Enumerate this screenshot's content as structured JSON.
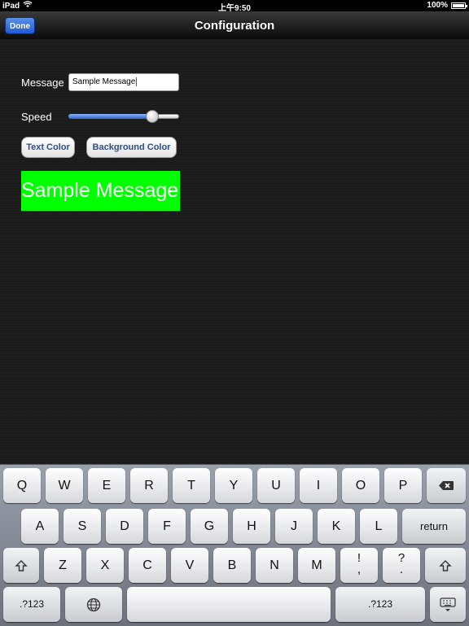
{
  "status": {
    "device": "iPad",
    "time": "上午9:50",
    "battery": "100%"
  },
  "nav": {
    "title": "Configuration",
    "done_label": "Done"
  },
  "form": {
    "message_label": "Message",
    "message_value": "Sample Message",
    "speed_label": "Speed",
    "speed_fraction": 0.79,
    "text_color_label": "Text Color",
    "background_color_label": "Background Color",
    "preview_text": "Sample Message",
    "preview_bg": "#00ff00",
    "preview_text_color": "#ffffff"
  },
  "keyboard": {
    "row1": [
      "Q",
      "W",
      "E",
      "R",
      "T",
      "Y",
      "U",
      "I",
      "O",
      "P"
    ],
    "row2": [
      "A",
      "S",
      "D",
      "F",
      "G",
      "H",
      "J",
      "K",
      "L"
    ],
    "row2_return": "return",
    "row3": [
      "Z",
      "X",
      "C",
      "V",
      "B",
      "N",
      "M"
    ],
    "row3_punct1_top": "!",
    "row3_punct1_bottom": ",",
    "row3_punct2_top": "?",
    "row3_punct2_bottom": ".",
    "num_key": ".?123"
  }
}
